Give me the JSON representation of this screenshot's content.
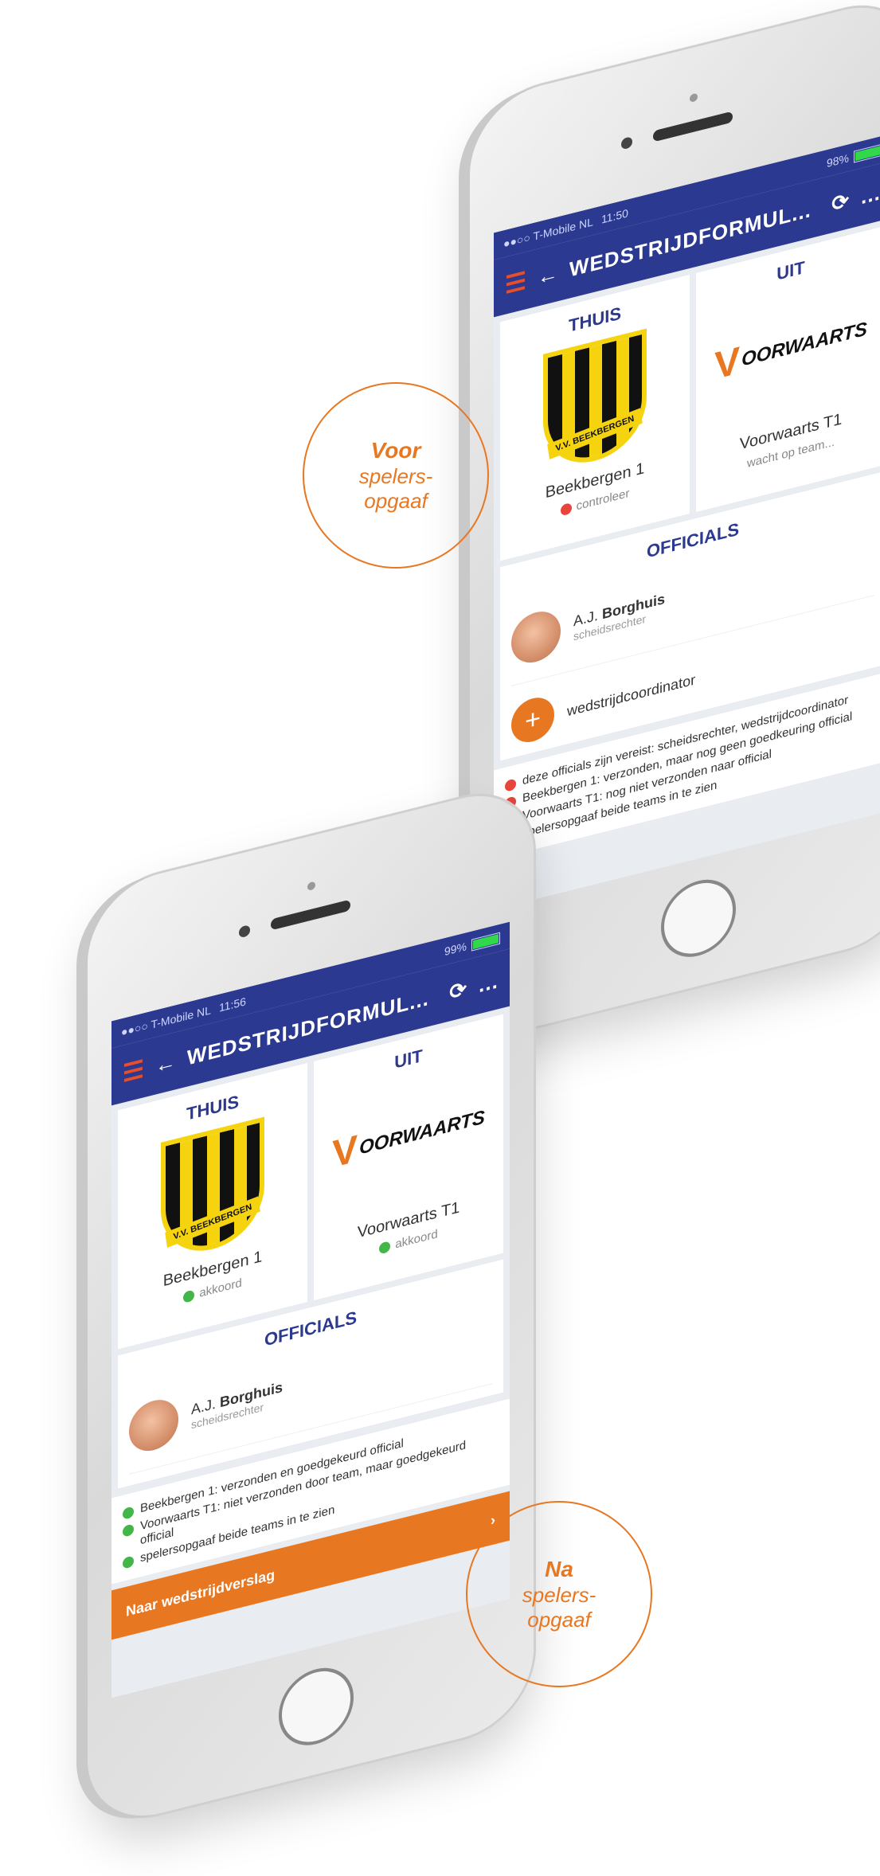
{
  "top_phone": {
    "status": {
      "carrier": "●●○○ T-Mobile NL",
      "time": "11:50",
      "battery": "98%"
    },
    "appbar": {
      "title": "WEDSTRIJDFORMUL...",
      "back": "←",
      "refresh": "⟳",
      "more": "…"
    },
    "home_team": {
      "label": "THUIS",
      "name": "Beekbergen 1",
      "status": "controleer",
      "crest_text": "V.V. BEEKBERGEN"
    },
    "away_team": {
      "label": "UIT",
      "name": "Voorwaarts T1",
      "status": "wacht op team...",
      "logo_mark": "V",
      "logo_text": "OORWAARTS"
    },
    "officials": {
      "heading": "OFFICIALS",
      "official_name_prefix": "A.J.",
      "official_name": "Borghuis",
      "official_role": "scheidsrechter",
      "add_label": "wedstrijdcoordinator",
      "add_symbol": "+"
    },
    "notes": [
      {
        "color": "red",
        "text": "deze officials zijn vereist: scheidsrechter, wedstrijdcoordinator"
      },
      {
        "color": "red",
        "text": "Beekbergen 1: verzonden, maar nog geen goedkeuring official"
      },
      {
        "color": "red",
        "text": "Voorwaarts T1: nog niet verzonden naar official"
      },
      {
        "color": "green",
        "text": "spelersopgaaf beide teams in te zien"
      }
    ]
  },
  "bottom_phone": {
    "status": {
      "carrier": "●●○○ T-Mobile NL",
      "time": "11:56",
      "battery": "99%"
    },
    "appbar": {
      "title": "WEDSTRIJDFORMUL...",
      "back": "←",
      "refresh": "⟳",
      "more": "…"
    },
    "home_team": {
      "label": "THUIS",
      "name": "Beekbergen 1",
      "status": "akkoord",
      "crest_text": "V.V. BEEKBERGEN"
    },
    "away_team": {
      "label": "UIT",
      "name": "Voorwaarts T1",
      "status": "akkoord",
      "logo_mark": "V",
      "logo_text": "OORWAARTS"
    },
    "officials": {
      "heading": "OFFICIALS",
      "official_name_prefix": "A.J.",
      "official_name": "Borghuis",
      "official_role": "scheidsrechter"
    },
    "notes": [
      {
        "color": "green",
        "text": "Beekbergen 1: verzonden en goedgekeurd official"
      },
      {
        "color": "green",
        "text": "Voorwaarts T1: niet verzonden door team, maar goedgekeurd official"
      },
      {
        "color": "green",
        "text": "spelersopgaaf beide teams in te zien"
      }
    ],
    "cta": {
      "label": "Naar wedstrijdverslag",
      "chevron": "›"
    }
  },
  "callouts": {
    "voor": {
      "bold": "Voor",
      "line1": "spelers-",
      "line2": "opgaaf"
    },
    "na": {
      "bold": "Na",
      "line1": "spelers-",
      "line2": "opgaaf"
    }
  },
  "colors": {
    "accent": "#e87722",
    "navy": "#2b3990",
    "red": "#e8453c",
    "green": "#43b649"
  }
}
